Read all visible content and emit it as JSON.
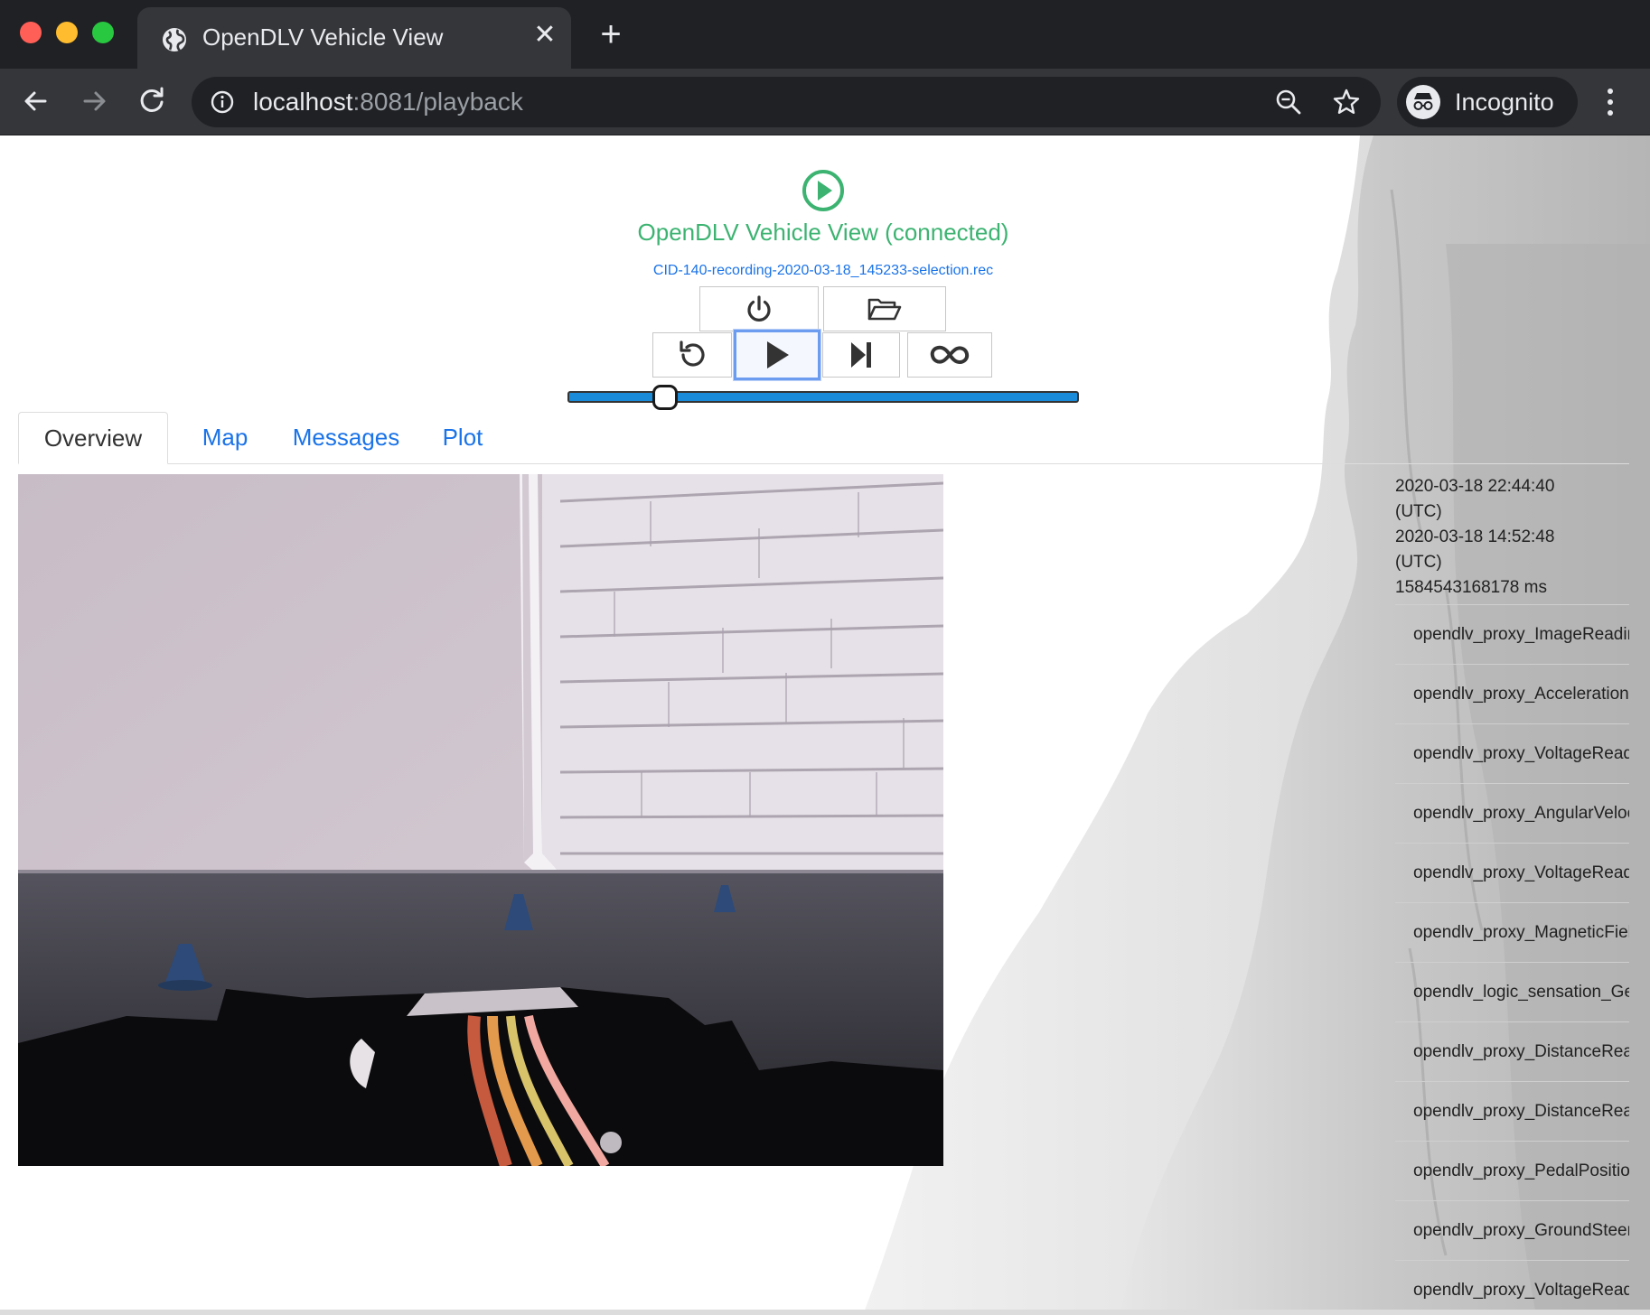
{
  "browser": {
    "tab_title": "OpenDLV Vehicle View",
    "tab_close": "✕",
    "new_tab": "+",
    "url_host": "localhost",
    "url_rest": ":8081/playback",
    "profile_label": "Incognito",
    "icons": [
      "globe-icon",
      "close-icon",
      "plus-icon",
      "back-arrow-icon",
      "forward-arrow-icon",
      "reload-icon",
      "info-icon",
      "zoom-out-icon",
      "star-icon",
      "incognito-icon",
      "kebab-menu-icon"
    ]
  },
  "app": {
    "title": "OpenDLV Vehicle View (connected)",
    "title_color": "#3cb371",
    "file_name": "CID-140-recording-2020-03-18_145233-selection.rec",
    "controls": [
      {
        "name": "power",
        "icon": "power-icon"
      },
      {
        "name": "open-folder",
        "icon": "folder-open-icon"
      },
      {
        "name": "replay",
        "icon": "replay-icon"
      },
      {
        "name": "play",
        "icon": "play-icon",
        "focused": true
      },
      {
        "name": "step-forward",
        "icon": "step-forward-icon"
      },
      {
        "name": "loop",
        "icon": "infinity-icon"
      }
    ],
    "playback_position_fraction": 0.19,
    "accent_color": "#1a8bd8"
  },
  "tabs": [
    {
      "label": "Overview",
      "active": true
    },
    {
      "label": "Map",
      "active": false
    },
    {
      "label": "Messages",
      "active": false
    },
    {
      "label": "Plot",
      "active": false
    }
  ],
  "video": {
    "description_icon": "camera-frame-image"
  },
  "sidepanel": {
    "timestamps": [
      "2020-03-18 22:44:40",
      "(UTC)",
      "2020-03-18 14:52:48",
      "(UTC)",
      "1584543168178 ms"
    ],
    "messages": [
      "opendlv_proxy_ImageReading",
      "opendlv_proxy_AccelerationReading",
      "opendlv_proxy_VoltageReading",
      "opendlv_proxy_AngularVelocityReading",
      "opendlv_proxy_VoltageReading",
      "opendlv_proxy_MagneticFieldReading",
      "opendlv_logic_sensation_Geolocation",
      "opendlv_proxy_DistanceReading",
      "opendlv_proxy_DistanceReading",
      "opendlv_proxy_PedalPositionRequest",
      "opendlv_proxy_GroundSteeringRequest",
      "opendlv_proxy_VoltageReading"
    ]
  }
}
